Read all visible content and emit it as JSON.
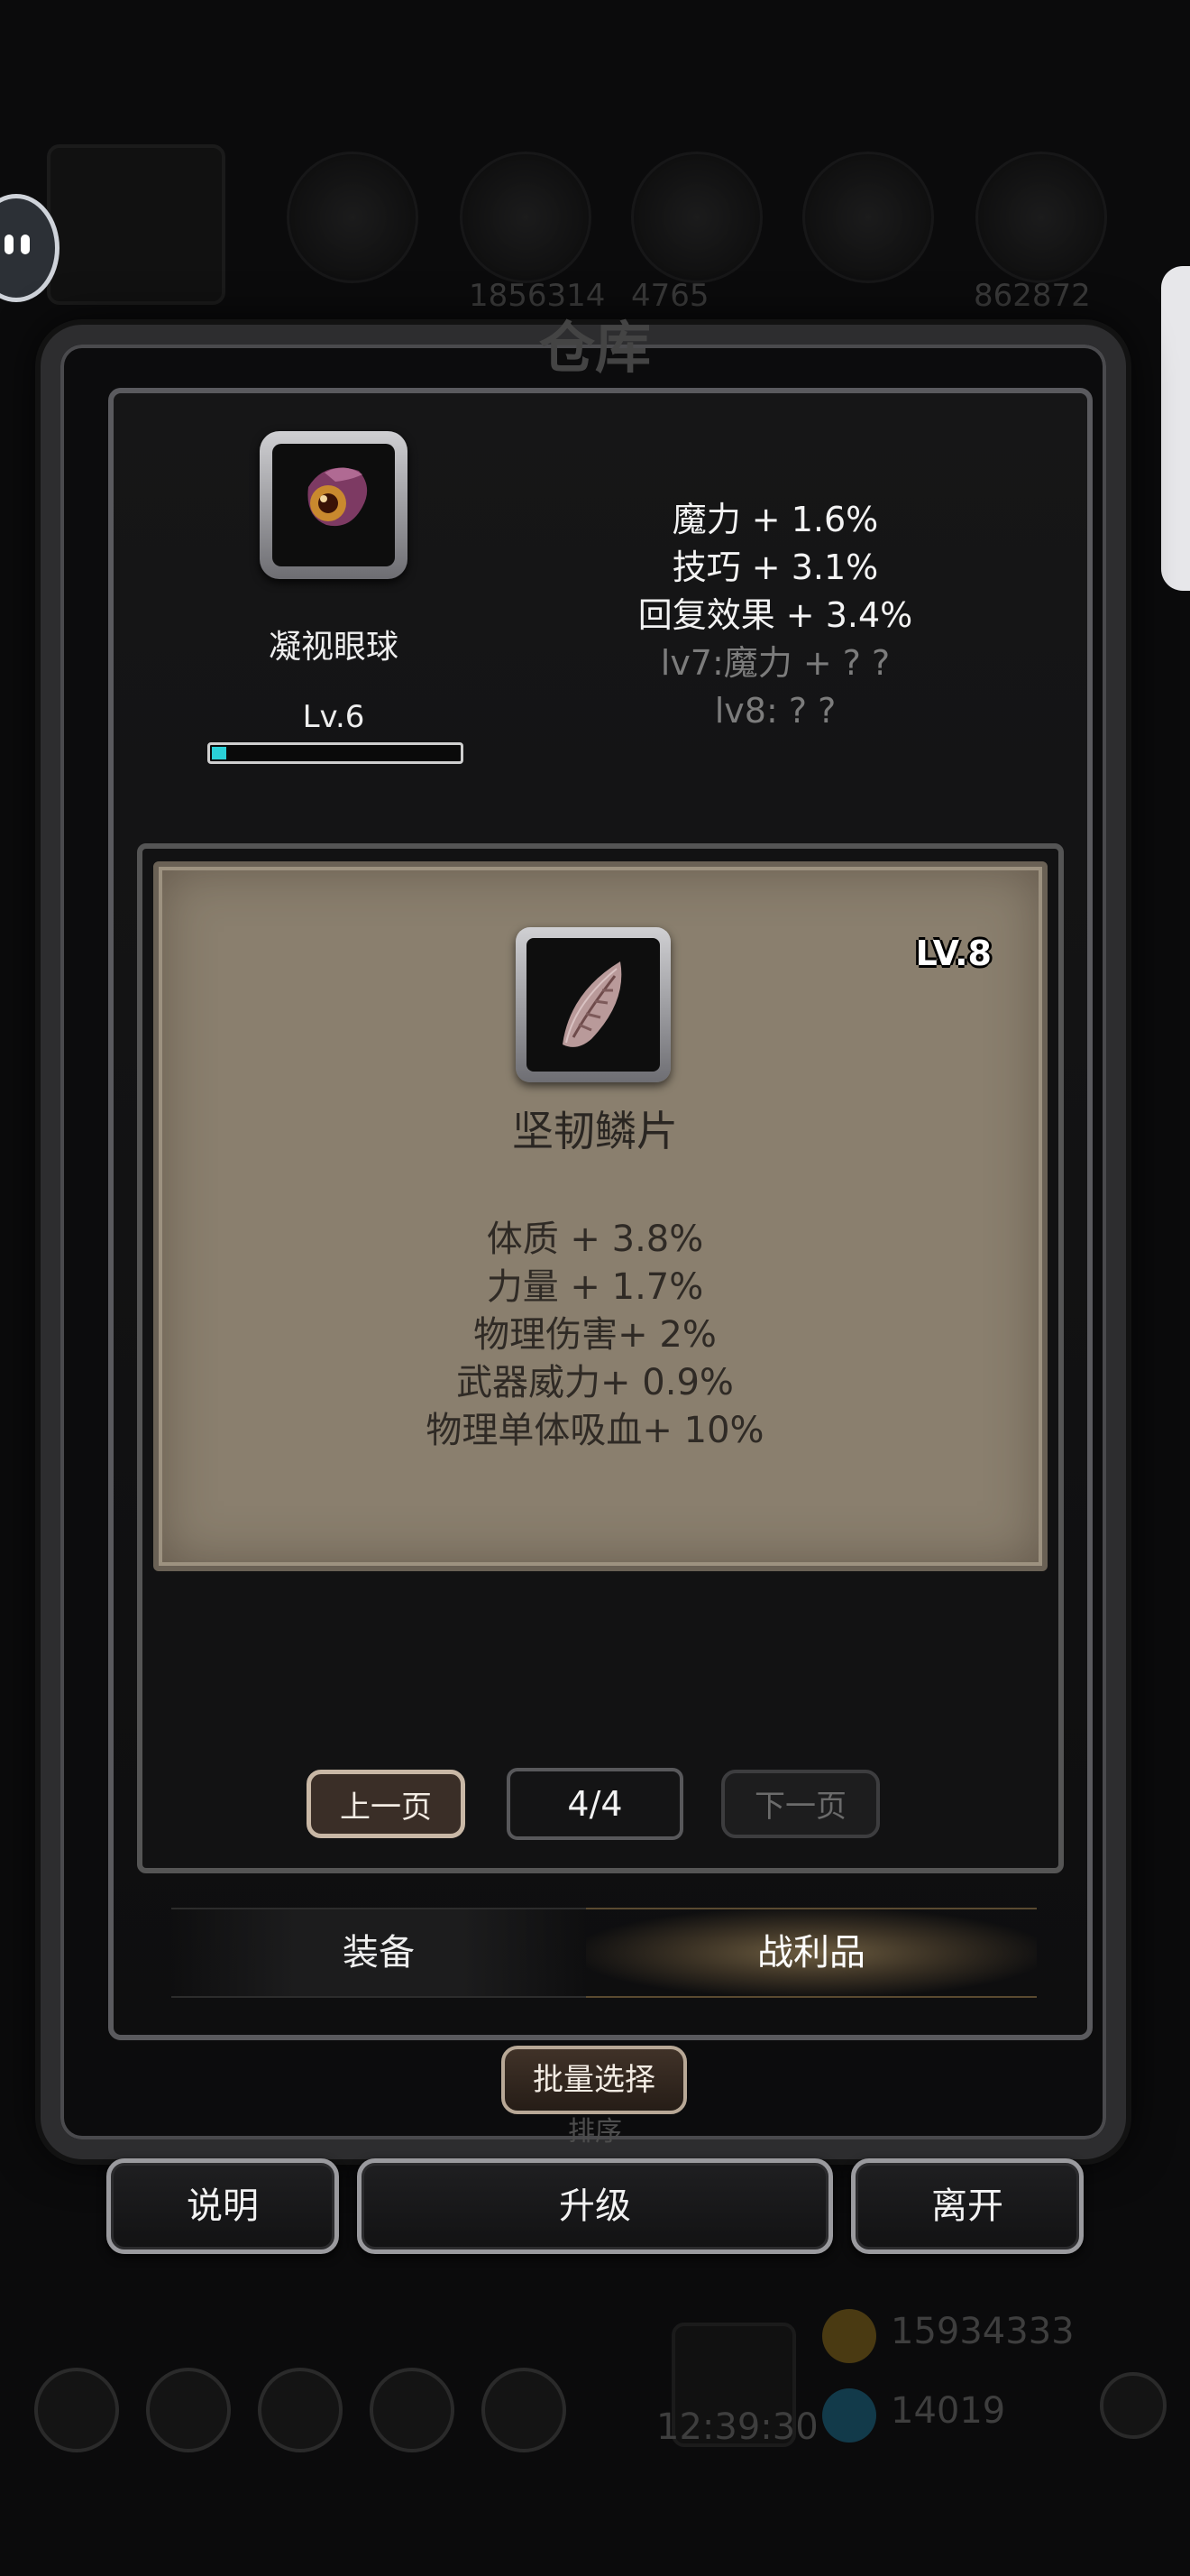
{
  "title": "仓库",
  "background_hud": {
    "top_numbers": [
      "1856314",
      "4765",
      "862872"
    ],
    "bottom_gold": "15934333",
    "bottom_gems": "14019",
    "clock": "12:39:30"
  },
  "selected_item": {
    "name": "凝视眼球",
    "level_label": "Lv.6",
    "level_progress": 0.06,
    "icon": "eyeball-icon",
    "stats": [
      {
        "text": "魔力 + 1.6%",
        "unlocked": true
      },
      {
        "text": "技巧 + 3.1%",
        "unlocked": true
      },
      {
        "text": "回复效果 + 3.4%",
        "unlocked": true
      },
      {
        "text": "lv7:魔力 + ? ?",
        "unlocked": false
      },
      {
        "text": "lv8: ? ?",
        "unlocked": false
      }
    ]
  },
  "detail_card": {
    "level": "LV.8",
    "name": "坚韧鳞片",
    "icon": "scale-icon",
    "stats": [
      "体质 + 3.8%",
      "力量 + 1.7%",
      "物理伤害+ 2%",
      "武器威力+ 0.9%",
      "物理单体吸血+ 10%"
    ]
  },
  "pager": {
    "prev_label": "上一页",
    "page": "4/4",
    "next_label": "下一页"
  },
  "tabs": [
    {
      "label": "装备",
      "active": false
    },
    {
      "label": "战利品",
      "active": true
    }
  ],
  "actions": {
    "batch_select": "批量选择",
    "sort": "排序",
    "info": "说明",
    "upgrade": "升级",
    "leave": "离开"
  },
  "colors": {
    "xp_bar": "#2ad0d8",
    "card_bg": "#8a7f6e",
    "active_tab_glow": "#6c5c40"
  }
}
